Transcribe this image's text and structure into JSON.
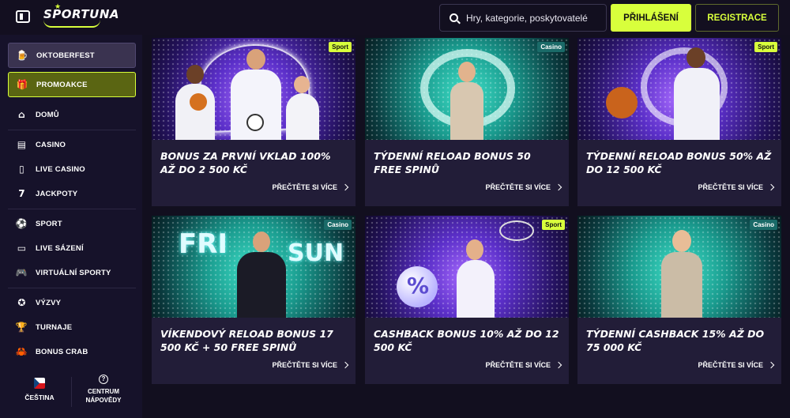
{
  "header": {
    "logo_text": "SPORTUNA",
    "search_placeholder": "Hry, kategorie, poskytovatelé",
    "login_label": "PŘIHLÁŠENÍ",
    "register_label": "REGISTRACE"
  },
  "sidebar": {
    "items": [
      {
        "label": "OKTOBERFEST",
        "icon": "beer-icon"
      },
      {
        "label": "PROMOAKCE",
        "icon": "gift-icon"
      },
      {
        "label": "DOMŮ",
        "icon": "home-icon"
      },
      {
        "label": "CASINO",
        "icon": "cards-icon"
      },
      {
        "label": "LIVE CASINO",
        "icon": "phone-icon"
      },
      {
        "label": "JACKPOTY",
        "icon": "seven-icon"
      },
      {
        "label": "SPORT",
        "icon": "ball-icon"
      },
      {
        "label": "LIVE SÁZENÍ",
        "icon": "monitor-icon"
      },
      {
        "label": "VIRTUÁLNÍ SPORTY",
        "icon": "gamepad-icon"
      },
      {
        "label": "VÝZVY",
        "icon": "badge-icon"
      },
      {
        "label": "TURNAJE",
        "icon": "trophy-icon"
      },
      {
        "label": "BONUS CRAB",
        "icon": "crab-icon"
      }
    ],
    "language": "ČEŠTINA",
    "help_line1": "CENTRUM",
    "help_line2": "NÁPOVĚDY"
  },
  "promos": [
    {
      "title": "BONUS ZA PRVNÍ VKLAD 100% AŽ DO 2 500 KČ",
      "badge": "Sport",
      "more": "PŘEČTĚTE SI VÍCE"
    },
    {
      "title": "TÝDENNÍ RELOAD BONUS 50 FREE SPINŮ",
      "badge": "Casino",
      "more": "PŘEČTĚTE SI VÍCE"
    },
    {
      "title": "TÝDENNÍ RELOAD BONUS 50% AŽ DO 12 500 KČ",
      "badge": "Sport",
      "more": "PŘEČTĚTE SI VÍCE"
    },
    {
      "title": "VÍKENDOVÝ RELOAD BONUS 17 500 KČ + 50 FREE SPINŮ",
      "badge": "Casino",
      "more": "PŘEČTĚTE SI VÍCE",
      "art_text_left": "FRI",
      "art_text_right": "SUN"
    },
    {
      "title": "CASHBACK BONUS 10% AŽ DO 12 500 KČ",
      "badge": "Sport",
      "more": "PŘEČTĚTE SI VÍCE",
      "art_text": "%"
    },
    {
      "title": "TÝDENNÍ CASHBACK 15% AŽ DO 75 000 KČ",
      "badge": "Casino",
      "more": "PŘEČTĚTE SI VÍCE"
    }
  ],
  "colors": {
    "accent": "#d8ff3c",
    "background": "#120f1f",
    "card": "#221d38",
    "promo_highlight": "#5a6512"
  }
}
